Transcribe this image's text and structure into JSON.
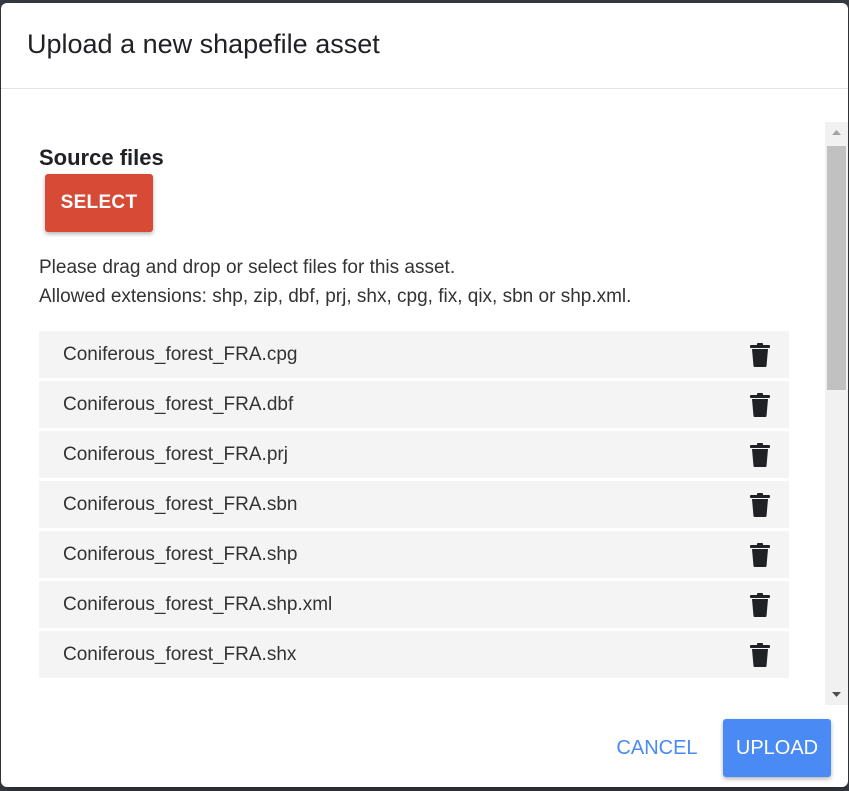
{
  "dialog": {
    "title": "Upload a new shapefile asset"
  },
  "source": {
    "title": "Source files",
    "select_label": "SELECT",
    "hint_line1": "Please drag and drop or select files for this asset.",
    "hint_line2": "Allowed extensions: shp, zip, dbf, prj, shx, cpg, fix, qix, sbn or shp.xml."
  },
  "files": [
    {
      "name": "Coniferous_forest_FRA.cpg"
    },
    {
      "name": "Coniferous_forest_FRA.dbf"
    },
    {
      "name": "Coniferous_forest_FRA.prj"
    },
    {
      "name": "Coniferous_forest_FRA.sbn"
    },
    {
      "name": "Coniferous_forest_FRA.shp"
    },
    {
      "name": "Coniferous_forest_FRA.shp.xml"
    },
    {
      "name": "Coniferous_forest_FRA.shx"
    }
  ],
  "actions": {
    "cancel_label": "CANCEL",
    "upload_label": "UPLOAD"
  },
  "icons": {
    "delete": "trash-icon"
  },
  "colors": {
    "select_button": "#d64a36",
    "primary": "#4a8af4",
    "row_background": "#f4f4f4"
  }
}
